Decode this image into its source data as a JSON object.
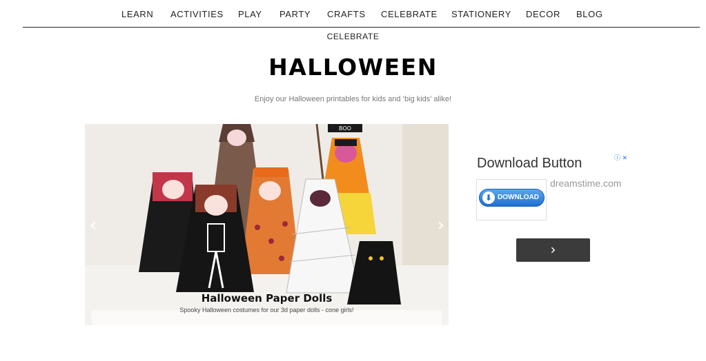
{
  "nav": {
    "items": [
      {
        "label": "LEARN"
      },
      {
        "label": "ACTIVITIES"
      },
      {
        "label": "PLAY"
      },
      {
        "label": "PARTY"
      },
      {
        "label": "CRAFTS"
      },
      {
        "label": "CELEBRATE"
      },
      {
        "label": "STATIONERY"
      },
      {
        "label": "DECOR"
      },
      {
        "label": "BLOG"
      }
    ]
  },
  "breadcrumb": {
    "label": "CELEBRATE"
  },
  "page": {
    "title": "HALLOWEEN",
    "subtitle": "Enjoy our Halloween printables for kids and ‘big kids’ alike!"
  },
  "slider": {
    "prev_glyph": "‹",
    "next_glyph": "›",
    "caption_title": "Halloween Paper Dolls",
    "caption_subtitle": "Spooky Halloween costumes for our 3d paper dolls - cone girls!",
    "sign_text": "BOO"
  },
  "ad": {
    "title": "Download Button",
    "info_glyph": "ⓘ ✕",
    "button_label": "DOWNLOAD",
    "button_icon": "⬇",
    "domain": "dreamstime.com",
    "next_glyph": "›"
  },
  "colors": {
    "nav_text": "#222222",
    "ad_button": "#1e6fd0",
    "next_button_bg": "#3b3b3b"
  }
}
